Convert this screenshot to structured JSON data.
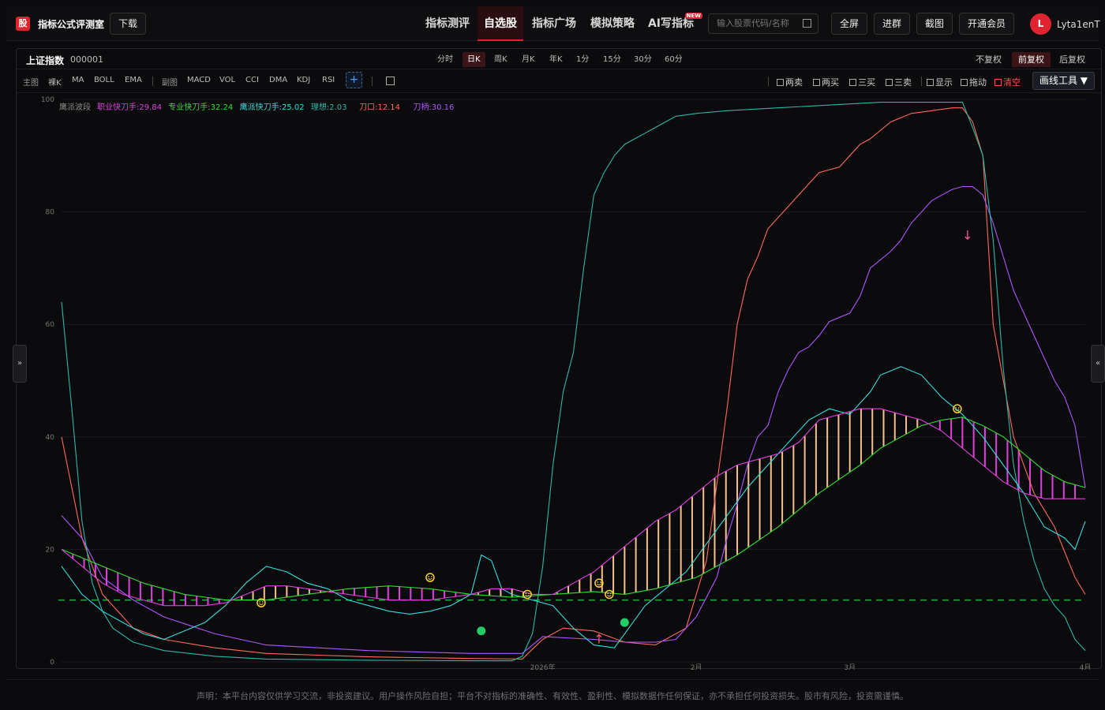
{
  "header": {
    "logo_char": "股",
    "app_title": "指标公式评测室",
    "download_label": "下载",
    "nav": [
      {
        "label": "指标测评",
        "active": false
      },
      {
        "label": "自选股",
        "active": true
      },
      {
        "label": "指标广场",
        "active": false
      },
      {
        "label": "模拟策略",
        "active": false
      },
      {
        "label": "AI写指标",
        "active": false,
        "badge": "NEW"
      }
    ],
    "search_placeholder": "输入股票代码/名称",
    "buttons": [
      "全屏",
      "进群",
      "截图",
      "开通会员"
    ],
    "avatar_letter": "L",
    "username": "Lyta1enT"
  },
  "toolbar": {
    "symbol_name": "上证指数",
    "symbol_code": "000001",
    "periods": [
      "分时",
      "日K",
      "周K",
      "月K",
      "年K",
      "1分",
      "15分",
      "30分",
      "60分"
    ],
    "active_period": "日K",
    "adjust": [
      "不复权",
      "前复权",
      "后复权"
    ],
    "active_adjust": "前复权",
    "main_label": "主图",
    "main_indicators": [
      "裸K",
      "MA",
      "BOLL",
      "EMA"
    ],
    "sub_label": "副图",
    "sub_indicators": [
      "MACD",
      "VOL",
      "CCI",
      "DMA",
      "KDJ",
      "RSI"
    ],
    "plus_label": "+",
    "signals": [
      "两卖",
      "两买",
      "三买",
      "三卖",
      "显示",
      "拖动"
    ],
    "clear_label": "清空",
    "draw_tools_label": "画线工具 ▼"
  },
  "legend": {
    "name": "鹰派波段",
    "items": [
      {
        "text": "职业快刀手:29.84",
        "color": "#e040e0"
      },
      {
        "text": "专业快刀手:32.24",
        "color": "#33dd33"
      },
      {
        "text": "鹰派快刀手:25.02",
        "color": "#33dddd"
      },
      {
        "text": "理想:2.03",
        "color": "#2ab8a8"
      },
      {
        "text": "刀口:12.14",
        "color": "#ff6a5a"
      },
      {
        "text": "刀柄:30.16",
        "color": "#b055ff"
      }
    ]
  },
  "chart_data": {
    "type": "line",
    "ylim": [
      0,
      100
    ],
    "y_ticks": [
      0,
      20,
      40,
      60,
      80,
      100
    ],
    "x_ticks": [
      {
        "label": "2026年",
        "x": 47
      },
      {
        "label": "2月",
        "x": 62
      },
      {
        "label": "3月",
        "x": 77
      },
      {
        "label": "4月",
        "x": 100
      }
    ],
    "xlim": [
      0,
      100
    ],
    "series": [
      {
        "name": "刀口",
        "color": "#ff6a5a",
        "points": [
          [
            0,
            40
          ],
          [
            2,
            22
          ],
          [
            4,
            12
          ],
          [
            7,
            6
          ],
          [
            10,
            4
          ],
          [
            15,
            2.5
          ],
          [
            20,
            1.5
          ],
          [
            30,
            0.9
          ],
          [
            40,
            0.6
          ],
          [
            45,
            0.5
          ],
          [
            47,
            4
          ],
          [
            49,
            6
          ],
          [
            52,
            5.5
          ],
          [
            55,
            3.5
          ],
          [
            58,
            3
          ],
          [
            61,
            6
          ],
          [
            63,
            18
          ],
          [
            65,
            45
          ],
          [
            66,
            60
          ],
          [
            67,
            68
          ],
          [
            68,
            72
          ],
          [
            69,
            77
          ],
          [
            71,
            81
          ],
          [
            72,
            83
          ],
          [
            74,
            87
          ],
          [
            76,
            88
          ],
          [
            78,
            92
          ],
          [
            79,
            93
          ],
          [
            81,
            96
          ],
          [
            83,
            97.5
          ],
          [
            85,
            98
          ],
          [
            87,
            98.5
          ],
          [
            88,
            98.5
          ],
          [
            89,
            96
          ],
          [
            90,
            90
          ],
          [
            91,
            60
          ],
          [
            93,
            40
          ],
          [
            95,
            30
          ],
          [
            97,
            24
          ],
          [
            99,
            15
          ],
          [
            100,
            12
          ]
        ]
      },
      {
        "name": "刀柄",
        "color": "#b055ff",
        "points": [
          [
            0,
            26
          ],
          [
            2,
            22
          ],
          [
            4,
            15
          ],
          [
            7,
            11
          ],
          [
            10,
            8
          ],
          [
            15,
            5
          ],
          [
            20,
            3
          ],
          [
            30,
            2
          ],
          [
            40,
            1.5
          ],
          [
            45,
            1.5
          ],
          [
            47,
            4.5
          ],
          [
            52,
            4
          ],
          [
            55,
            3.5
          ],
          [
            58,
            3.5
          ],
          [
            60,
            4
          ],
          [
            62,
            8
          ],
          [
            64,
            15
          ],
          [
            65,
            22
          ],
          [
            66,
            28
          ],
          [
            67,
            35
          ],
          [
            68,
            40
          ],
          [
            69,
            42
          ],
          [
            70,
            48
          ],
          [
            71,
            52
          ],
          [
            72,
            55
          ],
          [
            73,
            56
          ],
          [
            74,
            58
          ],
          [
            75,
            60.5
          ],
          [
            77,
            62
          ],
          [
            78,
            65
          ],
          [
            79,
            70
          ],
          [
            81,
            73
          ],
          [
            82,
            75
          ],
          [
            83,
            78
          ],
          [
            84,
            80
          ],
          [
            85,
            82
          ],
          [
            86,
            83
          ],
          [
            87,
            84
          ],
          [
            88,
            84.5
          ],
          [
            89,
            84.5
          ],
          [
            90,
            83
          ],
          [
            91,
            78
          ],
          [
            92,
            72
          ],
          [
            93,
            66
          ],
          [
            95,
            58
          ],
          [
            97,
            50
          ],
          [
            98,
            47
          ],
          [
            99,
            42
          ],
          [
            100,
            31
          ]
        ]
      },
      {
        "name": "理想",
        "color": "#2ab8a8",
        "points": [
          [
            0,
            64
          ],
          [
            1,
            45
          ],
          [
            2,
            25
          ],
          [
            3,
            14
          ],
          [
            4,
            9
          ],
          [
            5,
            6
          ],
          [
            7,
            3.5
          ],
          [
            10,
            2
          ],
          [
            15,
            1
          ],
          [
            20,
            0.5
          ],
          [
            30,
            0.3
          ],
          [
            40,
            0.2
          ],
          [
            44,
            0.2
          ],
          [
            45,
            1
          ],
          [
            46,
            5
          ],
          [
            47,
            17
          ],
          [
            48,
            35
          ],
          [
            49,
            48
          ],
          [
            50,
            55
          ],
          [
            51,
            70
          ],
          [
            52,
            83
          ],
          [
            53,
            87
          ],
          [
            54,
            90
          ],
          [
            55,
            92
          ],
          [
            56,
            93
          ],
          [
            57,
            94
          ],
          [
            58,
            95
          ],
          [
            59,
            96
          ],
          [
            60,
            97
          ],
          [
            62,
            97.5
          ],
          [
            65,
            98
          ],
          [
            70,
            98.5
          ],
          [
            80,
            99.5
          ],
          [
            88,
            99.5
          ],
          [
            89,
            95
          ],
          [
            90,
            90
          ],
          [
            91,
            75
          ],
          [
            92,
            52
          ],
          [
            93,
            35
          ],
          [
            94,
            25
          ],
          [
            95,
            18
          ],
          [
            96,
            13
          ],
          [
            97,
            10
          ],
          [
            98,
            8
          ],
          [
            99,
            4
          ],
          [
            100,
            2
          ]
        ]
      },
      {
        "name": "鹰派快刀手",
        "color": "#33dddd",
        "points": [
          [
            0,
            17
          ],
          [
            2,
            12
          ],
          [
            4,
            9
          ],
          [
            6,
            7
          ],
          [
            8,
            5
          ],
          [
            10,
            4
          ],
          [
            12,
            5.5
          ],
          [
            14,
            7
          ],
          [
            16,
            10
          ],
          [
            18,
            14
          ],
          [
            20,
            17
          ],
          [
            22,
            16
          ],
          [
            24,
            14
          ],
          [
            26,
            13
          ],
          [
            28,
            11
          ],
          [
            30,
            10
          ],
          [
            32,
            9
          ],
          [
            34,
            8.5
          ],
          [
            36,
            9
          ],
          [
            38,
            10
          ],
          [
            40,
            12
          ],
          [
            41,
            19
          ],
          [
            42,
            18
          ],
          [
            43,
            13
          ],
          [
            44,
            12
          ],
          [
            46,
            11
          ],
          [
            48,
            10
          ],
          [
            50,
            6
          ],
          [
            52,
            3
          ],
          [
            54,
            2.5
          ],
          [
            55,
            5
          ],
          [
            57,
            10
          ],
          [
            59,
            13
          ],
          [
            61,
            16
          ],
          [
            63,
            21
          ],
          [
            65,
            26
          ],
          [
            67,
            31
          ],
          [
            69,
            35
          ],
          [
            71,
            39
          ],
          [
            73,
            43
          ],
          [
            75,
            45
          ],
          [
            77,
            44
          ],
          [
            79,
            48
          ],
          [
            80,
            51
          ],
          [
            82,
            52.5
          ],
          [
            84,
            51
          ],
          [
            86,
            47
          ],
          [
            88,
            44
          ],
          [
            90,
            40
          ],
          [
            92,
            35
          ],
          [
            94,
            30
          ],
          [
            96,
            24
          ],
          [
            98,
            22
          ],
          [
            99,
            20
          ],
          [
            100,
            25
          ]
        ]
      },
      {
        "name": "专业快刀手",
        "color": "#33dd33",
        "points": [
          [
            0,
            20
          ],
          [
            4,
            17
          ],
          [
            8,
            14
          ],
          [
            12,
            12
          ],
          [
            16,
            11
          ],
          [
            20,
            11
          ],
          [
            24,
            12
          ],
          [
            28,
            13
          ],
          [
            32,
            13.5
          ],
          [
            36,
            13
          ],
          [
            40,
            12
          ],
          [
            44,
            11.5
          ],
          [
            48,
            12
          ],
          [
            52,
            12.5
          ],
          [
            55,
            12
          ],
          [
            58,
            13
          ],
          [
            62,
            15
          ],
          [
            66,
            19
          ],
          [
            70,
            24
          ],
          [
            74,
            30
          ],
          [
            78,
            35
          ],
          [
            80,
            38
          ],
          [
            82,
            40
          ],
          [
            84,
            42
          ],
          [
            86,
            43
          ],
          [
            88,
            43.5
          ],
          [
            90,
            42
          ],
          [
            92,
            40
          ],
          [
            94,
            37
          ],
          [
            96,
            34
          ],
          [
            98,
            32
          ],
          [
            100,
            31
          ]
        ]
      },
      {
        "name": "职业快刀手",
        "color": "#e040e0",
        "points": [
          [
            0,
            20
          ],
          [
            2,
            17
          ],
          [
            4,
            14
          ],
          [
            6,
            12
          ],
          [
            8,
            11
          ],
          [
            10,
            10
          ],
          [
            12,
            10
          ],
          [
            14,
            10
          ],
          [
            16,
            10.5
          ],
          [
            18,
            12
          ],
          [
            20,
            13.5
          ],
          [
            22,
            13.5
          ],
          [
            24,
            13
          ],
          [
            26,
            12.5
          ],
          [
            28,
            12
          ],
          [
            30,
            11.5
          ],
          [
            32,
            11
          ],
          [
            34,
            11
          ],
          [
            36,
            11
          ],
          [
            38,
            11.5
          ],
          [
            40,
            12
          ],
          [
            42,
            13
          ],
          [
            44,
            13
          ],
          [
            46,
            12
          ],
          [
            48,
            12
          ],
          [
            50,
            14
          ],
          [
            52,
            16
          ],
          [
            54,
            19
          ],
          [
            56,
            22
          ],
          [
            58,
            25
          ],
          [
            60,
            27
          ],
          [
            62,
            30
          ],
          [
            64,
            33
          ],
          [
            66,
            35
          ],
          [
            68,
            36
          ],
          [
            70,
            37
          ],
          [
            72,
            39
          ],
          [
            74,
            43
          ],
          [
            76,
            44
          ],
          [
            78,
            45
          ],
          [
            80,
            45
          ],
          [
            82,
            44
          ],
          [
            84,
            43
          ],
          [
            86,
            41
          ],
          [
            88,
            38
          ],
          [
            90,
            35
          ],
          [
            92,
            32
          ],
          [
            94,
            30
          ],
          [
            96,
            29
          ],
          [
            98,
            29
          ],
          [
            100,
            29
          ]
        ]
      }
    ],
    "dashed_level": 11,
    "markers": [
      {
        "type": "smiley",
        "x": 19.5,
        "y": 10.5
      },
      {
        "type": "smiley",
        "x": 36,
        "y": 15
      },
      {
        "type": "smiley",
        "x": 45.5,
        "y": 12
      },
      {
        "type": "smiley",
        "x": 52.5,
        "y": 14
      },
      {
        "type": "smiley",
        "x": 53.5,
        "y": 12
      },
      {
        "type": "smiley",
        "x": 87.5,
        "y": 45
      },
      {
        "type": "dot",
        "x": 41,
        "y": 5.5
      },
      {
        "type": "dot",
        "x": 55,
        "y": 7
      },
      {
        "type": "arrow-up",
        "x": 52.5,
        "y": 4
      },
      {
        "type": "arrow-down",
        "x": 88.5,
        "y": 76
      }
    ]
  },
  "footer": {
    "disclaimer": "声明：本平台内容仅供学习交流，非投资建议。用户操作风险自担；平台不对指标的准确性、有效性、盈利性、模拟数据作任何保证，亦不承担任何投资损失。股市有风险，投资需谨慎。"
  }
}
